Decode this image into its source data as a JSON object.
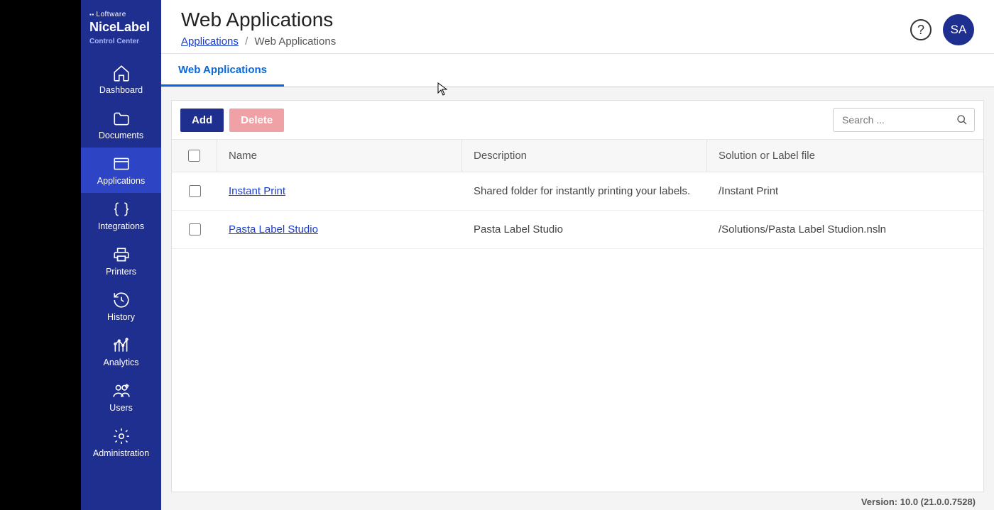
{
  "brand": {
    "company": "Loftware",
    "product": "NiceLabel",
    "sub": "Control Center"
  },
  "nav": {
    "dashboard": "Dashboard",
    "documents": "Documents",
    "applications": "Applications",
    "integrations": "Integrations",
    "printers": "Printers",
    "history": "History",
    "analytics": "Analytics",
    "users": "Users",
    "administration": "Administration"
  },
  "header": {
    "title": "Web Applications",
    "crumb_root": "Applications",
    "crumb_current": "Web Applications",
    "avatar": "SA"
  },
  "tabs": {
    "web_apps": "Web Applications"
  },
  "toolbar": {
    "add": "Add",
    "delete": "Delete"
  },
  "search": {
    "placeholder": "Search ..."
  },
  "columns": {
    "name": "Name",
    "description": "Description",
    "solution": "Solution or Label file"
  },
  "rows": [
    {
      "name": "Instant Print",
      "description": "Shared folder for instantly printing your labels.",
      "solution": "/Instant Print"
    },
    {
      "name": "Pasta Label Studio",
      "description": "Pasta Label Studio",
      "solution": "/Solutions/Pasta Label Studion.nsln"
    }
  ],
  "footer": {
    "version": "Version: 10.0 (21.0.0.7528)"
  }
}
